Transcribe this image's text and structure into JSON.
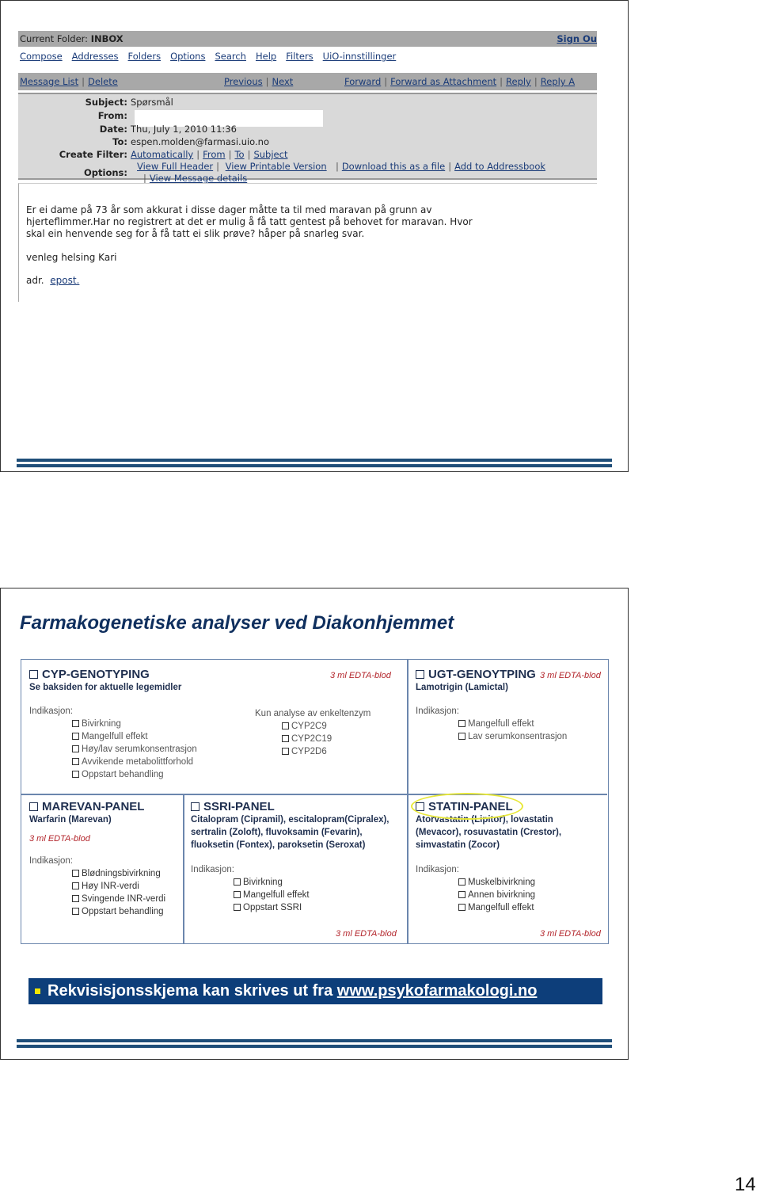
{
  "slide1": {
    "webmail": {
      "current_folder_label": "Current Folder:",
      "current_folder": "INBOX",
      "sign_out": "Sign Ou",
      "menu": [
        "Compose",
        "Addresses",
        "Folders",
        "Options",
        "Search",
        "Help",
        "Filters",
        "UiO-innstillinger"
      ],
      "nav_left": [
        "Message List",
        "Delete"
      ],
      "nav_mid": [
        "Previous",
        "Next"
      ],
      "nav_right": [
        "Forward",
        "Forward as Attachment",
        "Reply",
        "Reply A"
      ],
      "header": {
        "subject_label": "Subject:",
        "subject": "Spørsmål",
        "from_label": "From:",
        "date_label": "Date:",
        "date": "Thu, July 1, 2010 11:36",
        "to_label": "To:",
        "to": "espen.molden@farmasi.uio.no",
        "create_filter_label": "Create Filter:",
        "create_filter": [
          "Automatically",
          "From",
          "To",
          "Subject"
        ],
        "options_label": "Options:",
        "options": [
          "View Full Header",
          "View Printable Version",
          "Download this as a file",
          "Add to Addressbook",
          "View Message details"
        ]
      },
      "body": {
        "lines": [
          "Er ei dame på 73 år som akkurat i disse dager måtte ta til med maravan på grunn av",
          "hjerteflimmer.Har no registrert at det er mulig å få tatt gentest på behovet for maravan.  Hvor",
          "skal ein henvende seg for å få tatt ei slik prøve?  håper på snarleg svar."
        ],
        "signoff": "venleg helsing Kari",
        "adr_label": "adr.",
        "adr_link": "epost."
      }
    }
  },
  "slide2": {
    "title": "Farmakogenetiske analyser ved Diakonhjemmet",
    "cyp": {
      "title": "CYP-GENOTYPING",
      "subtitle": "Se baksiden for aktuelle legemidler",
      "sample": "3 ml EDTA-blod",
      "indication_label": "Indikasjon:",
      "indications": [
        "Bivirkning",
        "Mangelfull effekt",
        "Høy/lav serumkonsentrasjon",
        "Avvikende metabolittforhold",
        "Oppstart behandling"
      ],
      "enzyme_label": "Kun analyse av enkeltenzym",
      "enzymes": [
        "CYP2C9",
        "CYP2C19",
        "CYP2D6"
      ]
    },
    "ugt": {
      "title": "UGT-GENOYTPING",
      "sample": "3 ml EDTA-blod",
      "subtitle": "Lamotrigin (Lamictal)",
      "indication_label": "Indikasjon:",
      "indications": [
        "Mangelfull effekt",
        "Lav serumkonsentrasjon"
      ]
    },
    "marevan": {
      "title": "MAREVAN-PANEL",
      "subtitle": "Warfarin (Marevan)",
      "sample": "3 ml EDTA-blod",
      "indication_label": "Indikasjon:",
      "indications": [
        "Blødningsbivirkning",
        "Høy INR-verdi",
        "Svingende INR-verdi",
        "Oppstart behandling"
      ]
    },
    "ssri": {
      "title": "SSRI-PANEL",
      "drugs": [
        "Citalopram (Cipramil), escitalopram(Cipralex),",
        "sertralin (Zoloft), fluvoksamin (Fevarin),",
        "fluoksetin (Fontex), paroksetin  (Seroxat)"
      ],
      "indication_label": "Indikasjon:",
      "indications": [
        "Bivirkning",
        "Mangelfull effekt",
        "Oppstart SSRI"
      ],
      "sample": "3 ml EDTA-blod"
    },
    "statin": {
      "title": "STATIN-PANEL",
      "drugs": [
        "Atorvastatin (Lipitor), lovastatin",
        "(Mevacor), rosuvastatin (Crestor),",
        "simvastatin (Zocor)"
      ],
      "indication_label": "Indikasjon:",
      "indications": [
        "Muskelbivirkning",
        "Annen bivirkning",
        "Mangelfull effekt"
      ],
      "sample": "3 ml EDTA-blod",
      "highlight_color": "#e8e83a"
    },
    "banner": {
      "text": "Rekvisisjonsskjema kan skrives ut fra ",
      "link": "www.psykofarmakologi.no"
    }
  },
  "page_number": "14",
  "colors": {
    "title_blue": "#0f2f5e",
    "rule_blue": "#1f4e79",
    "banner_blue": "#0d3e7a",
    "sample_red": "#b3262c",
    "bullet_yellow": "#f2e600"
  }
}
